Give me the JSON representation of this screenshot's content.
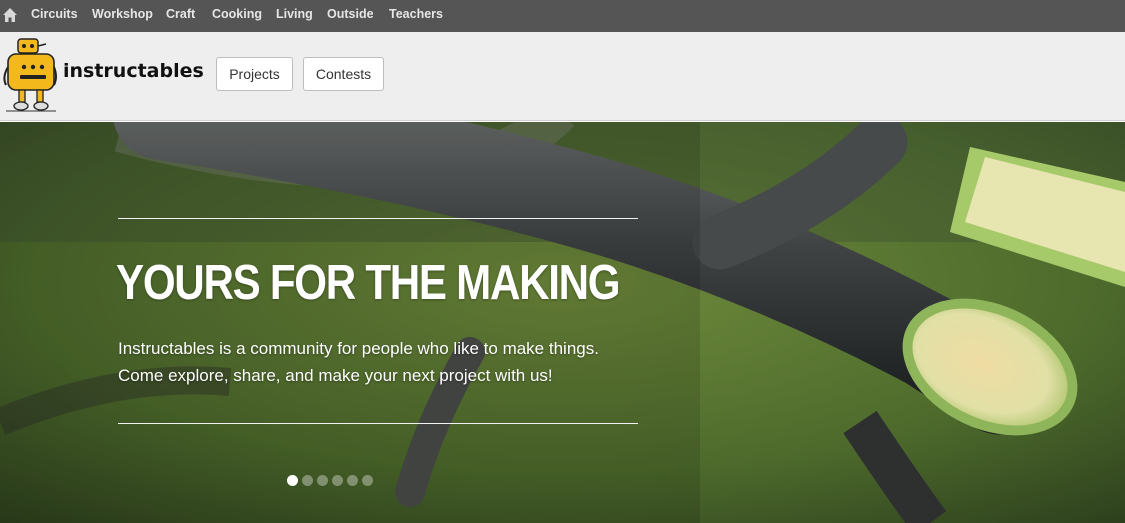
{
  "topnav": {
    "home_icon": "home-icon",
    "categories": [
      "Circuits",
      "Workshop",
      "Craft",
      "Cooking",
      "Living",
      "Outside",
      "Teachers"
    ]
  },
  "header": {
    "logo_icon": "robot-mascot-icon",
    "brand": "instructables",
    "buttons": [
      "Projects",
      "Contests"
    ]
  },
  "hero": {
    "headline": "YOURS FOR THE MAKING",
    "subtitle_line1": "Instructables is a community for people who like to make things.",
    "subtitle_line2": "Come explore, share, and make your next project with us!",
    "carousel": {
      "total_slides": 6,
      "active_slide": 1
    }
  },
  "colors": {
    "topnav_bg": "#555555",
    "header_bg": "#eeeeee",
    "hero_green": "#4c6a2c",
    "robot_yellow": "#f2b81c"
  }
}
